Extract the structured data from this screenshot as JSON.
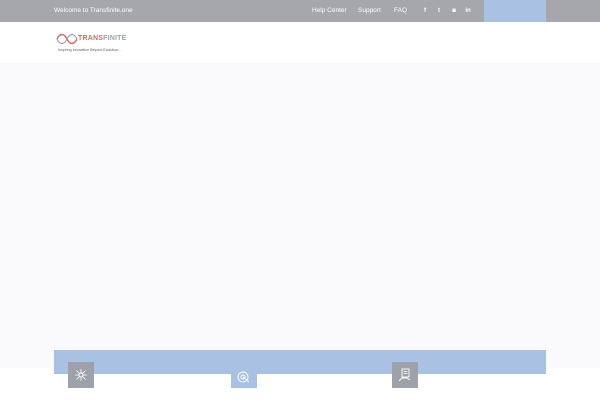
{
  "topbar": {
    "welcome": "Welcome to Transfinite.one",
    "links": [
      {
        "label": "Help Center"
      },
      {
        "label": "Support"
      },
      {
        "label": "FAQ"
      }
    ],
    "social": [
      {
        "icon": "facebook-icon",
        "glyph": "f"
      },
      {
        "icon": "twitter-icon",
        "glyph": "t"
      },
      {
        "icon": "instagram-icon",
        "glyph": "◙"
      },
      {
        "icon": "linkedin-icon",
        "glyph": "in"
      }
    ]
  },
  "brand": {
    "name_part1": "TRANS",
    "name_part2": "FINITE",
    "tagline": "Inspiring Innovation Beyond Evolution..."
  },
  "features": [
    {
      "icon": "network-icon"
    },
    {
      "icon": "target-icon"
    },
    {
      "icon": "document-hand-icon"
    }
  ],
  "colors": {
    "topbar": "#a6a7ab",
    "accent": "#a9c1e3",
    "brand_red": "#d36a6a",
    "card": "#9ea1a9"
  }
}
